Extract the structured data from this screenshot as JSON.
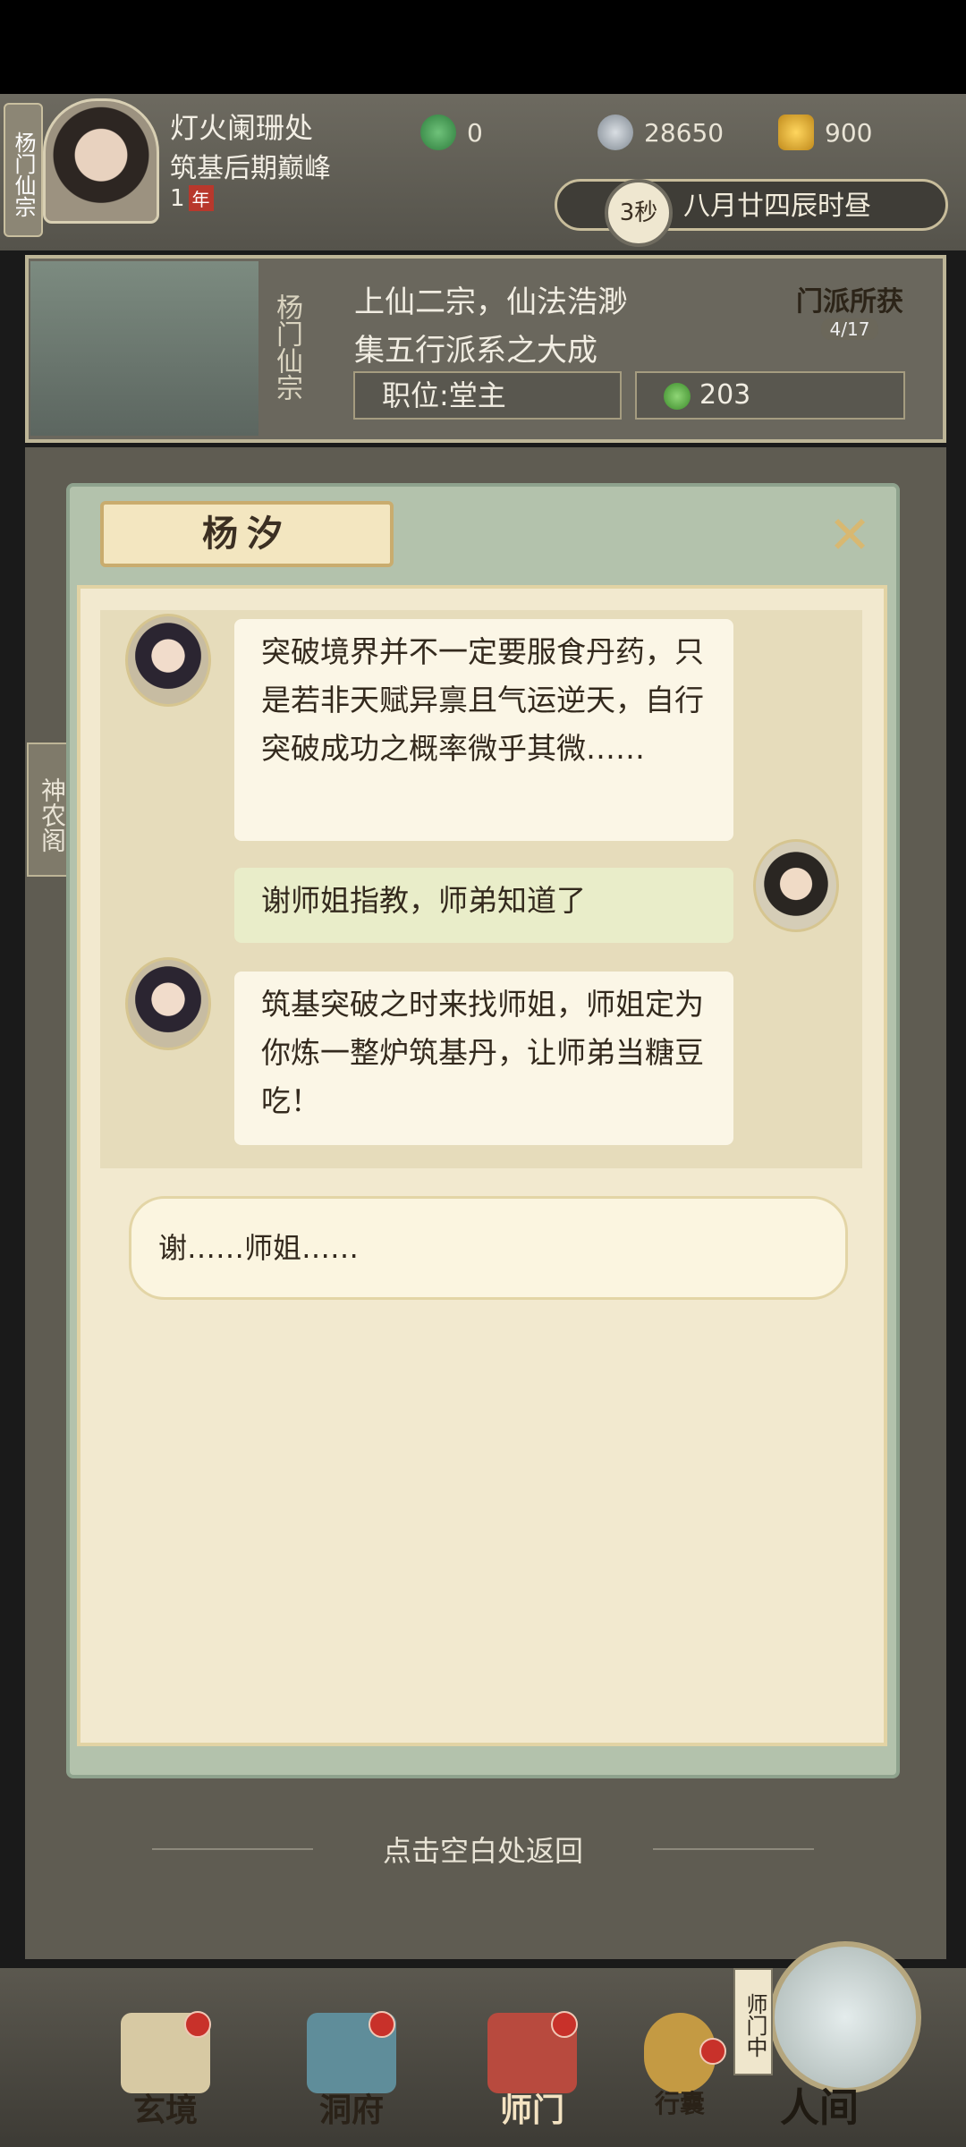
{
  "player": {
    "sect_tag": "杨门仙宗",
    "name": "灯火阑珊处",
    "rank": "筑基后期巅峰",
    "age_value": "1",
    "age_unit": "年"
  },
  "resources": [
    {
      "icon": "jade-icon",
      "value": "0"
    },
    {
      "icon": "coin-icon",
      "value": "28650"
    },
    {
      "icon": "gold-icon",
      "value": "900"
    }
  ],
  "clock": {
    "timer": "3秒",
    "date": "八月廿四辰时昼"
  },
  "sect": {
    "vertical_name": "杨门仙宗",
    "desc_line1": "上仙二宗，仙法浩渺",
    "desc_line2": "集五行派系之大成",
    "position": "职位:堂主",
    "contribution": "203",
    "reward_title": "门派所获",
    "reward_count": "4/17"
  },
  "side": {
    "shennong": "神农阁"
  },
  "dialog": {
    "title": "杨汐",
    "close_icon": "close-x-icon",
    "messages": [
      {
        "speaker": "npc",
        "text": "突破境界并不一定要服食丹药，只是若非天赋异禀且气运逆天，自行突破成功之概率微乎其微……"
      },
      {
        "speaker": "player",
        "text": "谢师姐指教，师弟知道了"
      },
      {
        "speaker": "npc",
        "text": "筑基突破之时来找师姐，师姐定为你炼一整炉筑基丹，让师弟当糖豆吃！"
      }
    ],
    "reply": "谢……师姐……"
  },
  "hint": "点击空白处返回",
  "nav": {
    "items": [
      {
        "label": "玄境"
      },
      {
        "label": "洞府"
      },
      {
        "label": "师门"
      },
      {
        "label": "行囊"
      }
    ],
    "sect_status": "师门中",
    "world": "人间"
  }
}
